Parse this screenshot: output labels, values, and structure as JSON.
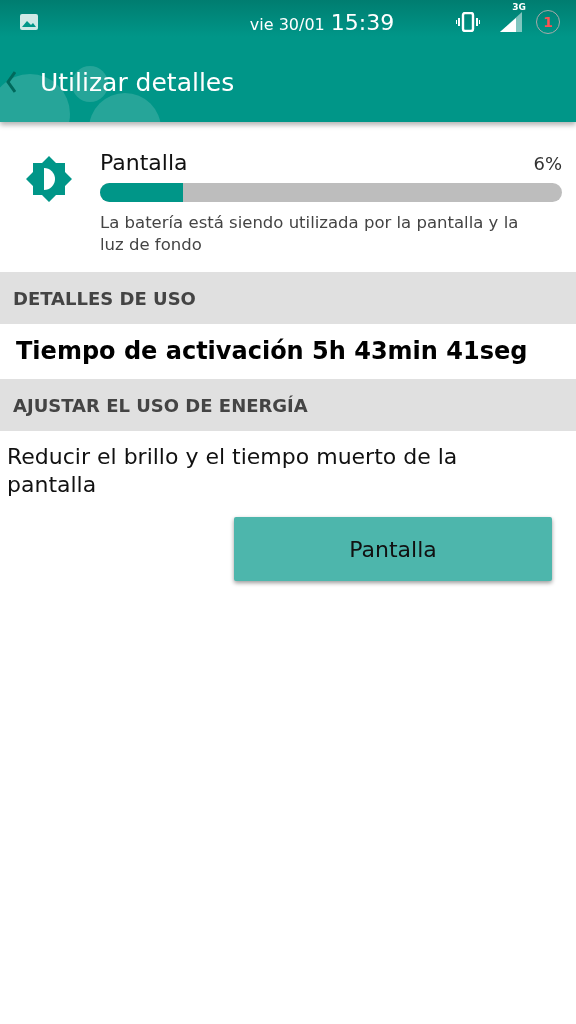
{
  "status_bar": {
    "date": "vie 30/01",
    "time": "15:39",
    "network": "3G",
    "notification_count": "1"
  },
  "app_bar": {
    "title": "Utilizar detalles"
  },
  "usage_item": {
    "title": "Pantalla",
    "percent": "6%",
    "level": 0.18,
    "description": "La batería está siendo utilizada por la pantalla y la luz de fondo"
  },
  "sections": [
    {
      "header": "DETALLES DE USO",
      "kind": "text",
      "text": "Tiempo de activación 5h 43min 41seg"
    },
    {
      "header": "AJUSTAR EL USO DE ENERGÍA",
      "kind": "action",
      "text": "Reducir el brillo y el tiempo muerto de la pantalla",
      "button": "Pantalla"
    }
  ]
}
